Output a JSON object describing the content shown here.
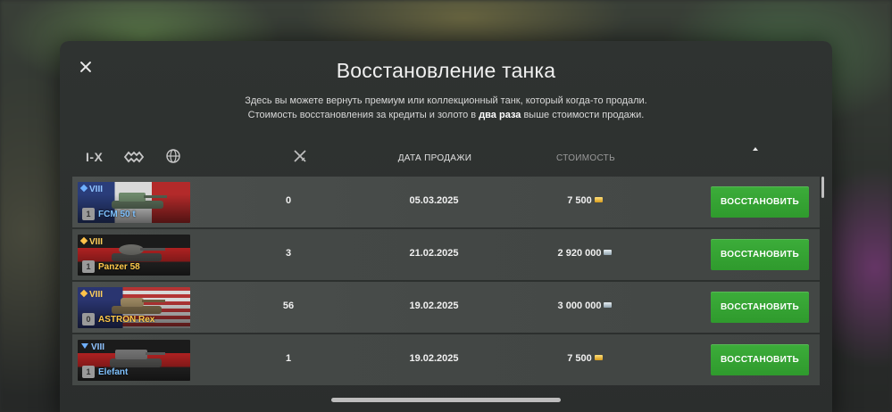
{
  "dialog": {
    "title": "Восстановление танка",
    "subtitle_line1": "Здесь вы можете вернуть премиум или коллекционный танк, который когда-то продали.",
    "subtitle_line2_pre": "Стоимость восстановления за кредиты и золото в ",
    "subtitle_line2_bold": "два раза",
    "subtitle_line2_post": " выше стоимости продажи."
  },
  "filters": {
    "tier_label": "I-X",
    "type_icon": "tank-type-icon",
    "nation_icon": "globe-icon"
  },
  "columns": {
    "battles_icon": "crossed-swords-icon",
    "date": "ДАТА ПРОДАЖИ",
    "cost": "СТОИМОСТЬ"
  },
  "rows": [
    {
      "tier": "VIII",
      "name": "FCM 50 t",
      "mastery": "1",
      "battles": "0",
      "date": "05.03.2025",
      "cost": "7 500",
      "currency": "gold",
      "button": "ВОССТАНОВИТЬ"
    },
    {
      "tier": "VIII",
      "name": "Panzer 58",
      "mastery": "1",
      "battles": "3",
      "date": "21.02.2025",
      "cost": "2 920 000",
      "currency": "credits",
      "button": "ВОССТАНОВИТЬ"
    },
    {
      "tier": "VIII",
      "name": "ASTRON Rex",
      "mastery": "0",
      "battles": "56",
      "date": "19.02.2025",
      "cost": "3 000 000",
      "currency": "credits",
      "button": "ВОССТАНОВИТЬ"
    },
    {
      "tier": "VIII",
      "name": "Elefant",
      "mastery": "1",
      "battles": "1",
      "date": "19.02.2025",
      "cost": "7 500",
      "currency": "gold",
      "button": "ВОССТАНОВИТЬ"
    }
  ],
  "colors": {
    "button_green": "#35a333",
    "tier_blue": "#7fc2ff",
    "tier_gold": "#ffc94a"
  }
}
